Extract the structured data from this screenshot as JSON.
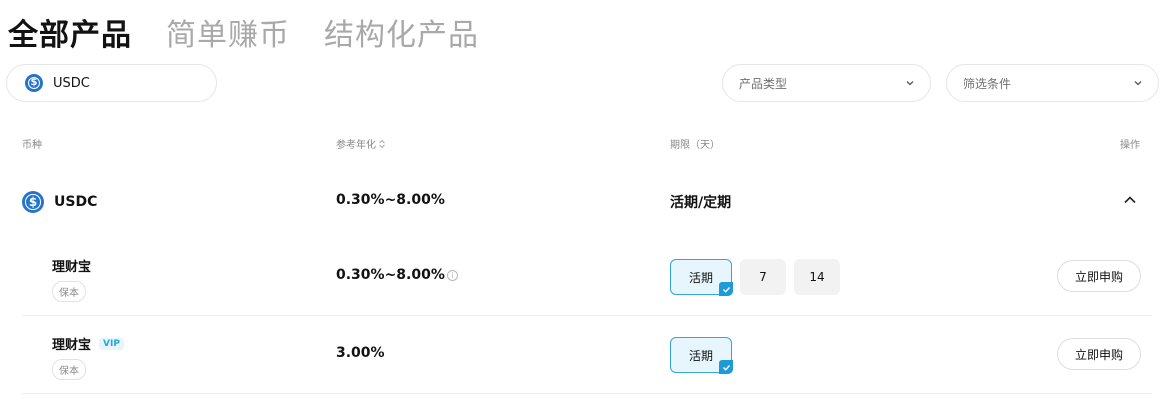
{
  "tabs": [
    {
      "label": "全部产品",
      "active": true
    },
    {
      "label": "简单赚币",
      "active": false
    },
    {
      "label": "结构化产品",
      "active": false
    }
  ],
  "coin_filter": {
    "value": "USDC",
    "icon": "usdc-icon"
  },
  "dropdowns": {
    "product_type": "产品类型",
    "filter": "筛选条件"
  },
  "table": {
    "headers": {
      "coin": "币种",
      "apr": "参考年化",
      "term": "期限（天）",
      "action": "操作"
    }
  },
  "coin_row": {
    "coin": "USDC",
    "apr": "0.30%~8.00%",
    "term": "活期/定期"
  },
  "products": [
    {
      "name": "理财宝",
      "vip": "",
      "tag": "保本",
      "apr": "0.30%~8.00%",
      "has_info": true,
      "terms": [
        {
          "label": "活期",
          "selected": true
        },
        {
          "label": "7",
          "selected": false
        },
        {
          "label": "14",
          "selected": false
        }
      ],
      "action": "立即申购"
    },
    {
      "name": "理财宝",
      "vip": "VIP",
      "tag": "保本",
      "apr": "3.00%",
      "has_info": false,
      "terms": [
        {
          "label": "活期",
          "selected": true
        }
      ],
      "action": "立即申购"
    }
  ],
  "colors": {
    "accent": "#1e9ad6",
    "usdc": "#2775ca",
    "muted": "#a9a9a9"
  }
}
